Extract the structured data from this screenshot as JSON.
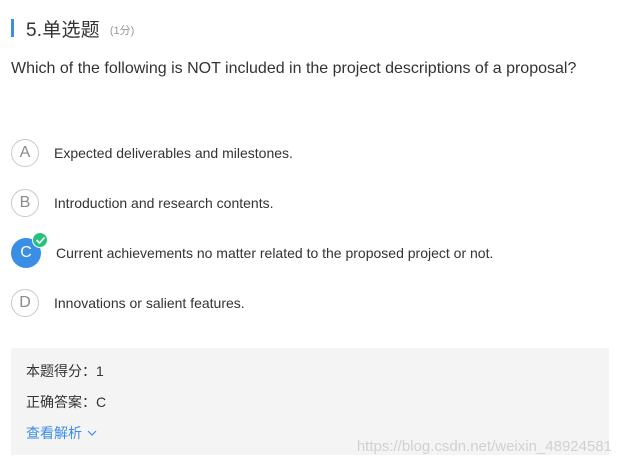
{
  "header": {
    "question_title": "5.单选题",
    "score": "(1分)",
    "accent_color": "#3a8ee6"
  },
  "question": {
    "text": "Which of the following is NOT included in the project descriptions of a proposal?"
  },
  "options": [
    {
      "letter": "A",
      "text": "Expected deliverables and milestones.",
      "selected": false
    },
    {
      "letter": "B",
      "text": "Introduction and research contents.",
      "selected": false
    },
    {
      "letter": "C",
      "text": "Current achievements no matter related to the proposed project or not.",
      "selected": true,
      "correct": true
    },
    {
      "letter": "D",
      "text": "Innovations or salient features.",
      "selected": false
    }
  ],
  "result": {
    "score_label": "本题得分：",
    "score_value": "1",
    "answer_label": "正确答案：",
    "answer_value": "C",
    "analysis_link": "查看解析",
    "analysis_icon": "chevron-down-icon"
  },
  "watermark": "https://blog.csdn.net/weixin_48924581",
  "colors": {
    "selected": "#3a8ee6",
    "correct_badge": "#28c07f",
    "result_bg": "#f4f4f4"
  }
}
